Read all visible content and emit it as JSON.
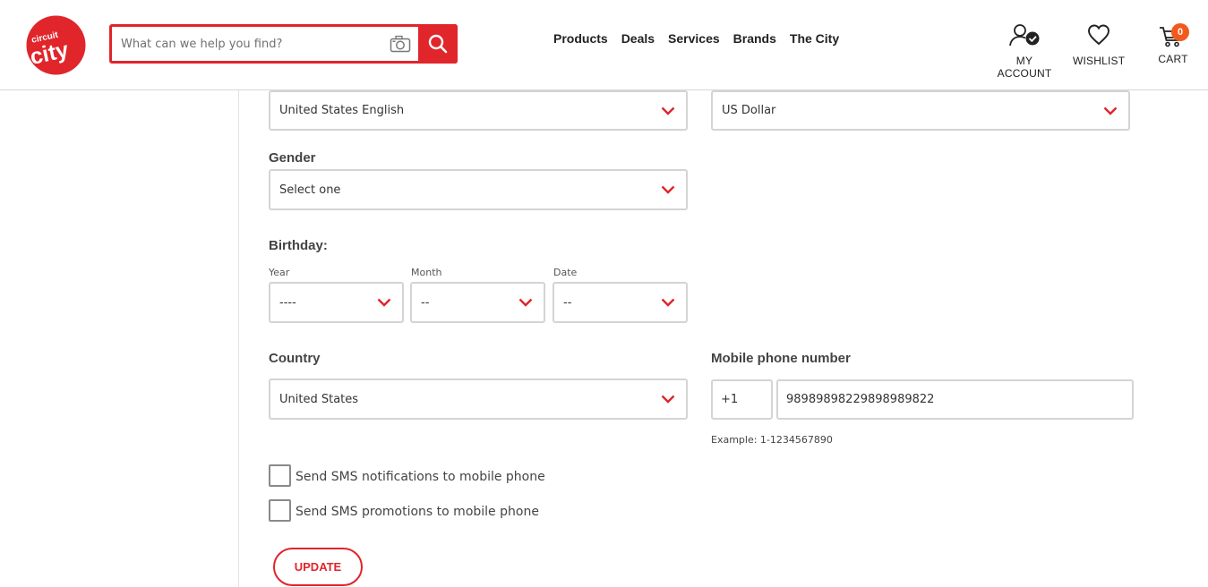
{
  "brand": {
    "name": "Circuit City",
    "logo_text_top": "circuit",
    "logo_text_main": "city",
    "color": "#e0252b"
  },
  "header": {
    "search": {
      "placeholder": "What can we help you find?",
      "value": ""
    },
    "nav": [
      "Products",
      "Deals",
      "Services",
      "Brands",
      "The City"
    ],
    "account_label": "MY ACCOUNT",
    "wishlist_label": "WISHLIST",
    "cart_label": "CART",
    "cart_count": "0"
  },
  "form": {
    "language": {
      "value": "United States English"
    },
    "currency": {
      "value": "US Dollar"
    },
    "gender": {
      "label": "Gender",
      "value": "Select one"
    },
    "birthday": {
      "label": "Birthday:",
      "year": {
        "label": "Year",
        "value": "----"
      },
      "month": {
        "label": "Month",
        "value": "--"
      },
      "date": {
        "label": "Date",
        "value": "--"
      }
    },
    "country": {
      "label": "Country",
      "value": "United States"
    },
    "mobile": {
      "label": "Mobile phone number",
      "code": "+1",
      "number": "98989898229898989822",
      "example": "Example: 1-1234567890"
    },
    "sms_notifications": {
      "label": "Send SMS notifications to mobile phone",
      "checked": false
    },
    "sms_promotions": {
      "label": "Send SMS promotions to mobile phone",
      "checked": false
    },
    "update_button": "UPDATE"
  },
  "colors": {
    "accent": "#e0252b",
    "badge": "#f25a1d",
    "border": "#d4d4d4"
  }
}
